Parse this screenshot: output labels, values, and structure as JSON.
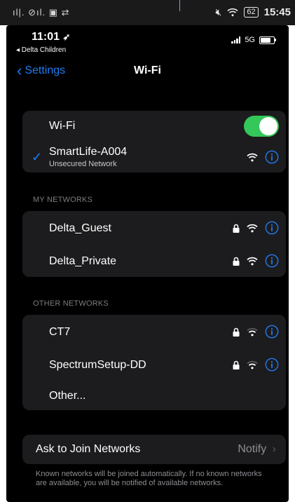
{
  "outer_status": {
    "icons_left": "ıl|. ⊘ıl. ▣ ⇄",
    "battery": "62",
    "time": "15:45"
  },
  "ios_status": {
    "time": "11:01",
    "back_app": "◂ Delta Children",
    "network": "5G"
  },
  "nav": {
    "back_label": "Settings",
    "title": "Wi-Fi"
  },
  "wifi_toggle": {
    "label": "Wi-Fi",
    "on": true
  },
  "connected": {
    "name": "SmartLife-A004",
    "subtitle": "Unsecured Network"
  },
  "my_networks": {
    "header": "MY NETWORKS",
    "items": [
      {
        "name": "Delta_Guest",
        "locked": true
      },
      {
        "name": "Delta_Private",
        "locked": true
      }
    ]
  },
  "other_networks": {
    "header": "OTHER NETWORKS",
    "items": [
      {
        "name": "CT7",
        "locked": true
      },
      {
        "name": "SpectrumSetup-DD",
        "locked": true
      }
    ],
    "other_label": "Other..."
  },
  "ask_to_join": {
    "label": "Ask to Join Networks",
    "value": "Notify"
  },
  "footer": "Known networks will be joined automatically. If no known networks are available, you will be notified of available networks.",
  "colors": {
    "accent": "#1e7cf2",
    "toggle_on": "#34c759",
    "background": "#000000",
    "cell": "#1c1c1e"
  }
}
